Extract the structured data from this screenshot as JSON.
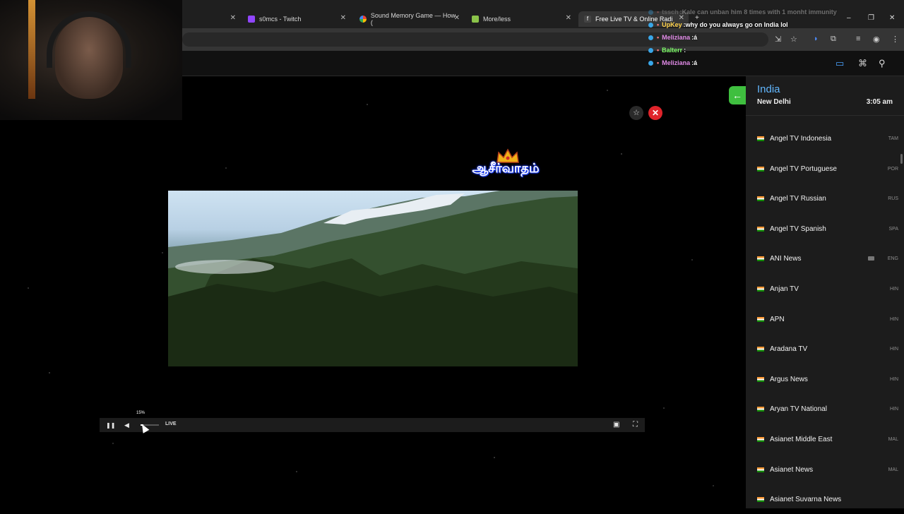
{
  "browser": {
    "tabs": [
      {
        "label": "",
        "active": false
      },
      {
        "label": "s0mcs - Twitch",
        "active": false
      },
      {
        "label": "Sound Memory Game — How (",
        "active": false
      },
      {
        "label": "More/less",
        "active": false
      },
      {
        "label": "Free Live TV & Online Radi",
        "active": true
      }
    ],
    "new_tab": "+",
    "window_controls": {
      "minimize": "–",
      "maximize": "❐",
      "close": "✕"
    }
  },
  "chat": {
    "messages": [
      {
        "user": "tssch",
        "text": "Kale can unban him 8 times with 1 monht immunity",
        "user_color": "#aaaaaa",
        "faded": true
      },
      {
        "user": "UpKey",
        "text": "why do you always go on India lol",
        "user_color": "#ffd24a",
        "faded": false
      },
      {
        "user": "Meliziana",
        "text": "á",
        "user_color": "#e08ae6",
        "faded": false
      },
      {
        "user": "Balterr",
        "text": "",
        "user_color": "#7fff6a",
        "faded": false
      },
      {
        "user": "Meliziana",
        "text": "á",
        "user_color": "#e08ae6",
        "faded": false
      }
    ]
  },
  "player": {
    "favorite_icon": "☆",
    "close_icon": "✕",
    "back_icon": "←",
    "overlay_text": "ஆசீர்வாதம்",
    "controls": {
      "pause_icon": "❚❚",
      "volume_icon": "◀",
      "volume_level": 0.15,
      "volume_tooltip": "15%",
      "live_label": "LIVE",
      "pip_icon": "▣",
      "fullscreen_icon": "⛶"
    }
  },
  "panel": {
    "country": "India",
    "city": "New Delhi",
    "time": "3:05 am",
    "channels": [
      {
        "name": "Angel TV Indonesia",
        "lang": "TAM"
      },
      {
        "name": "Angel TV Portuguese",
        "lang": "POR"
      },
      {
        "name": "Angel TV Russian",
        "lang": "RUS"
      },
      {
        "name": "Angel TV Spanish",
        "lang": "SPA"
      },
      {
        "name": "ANI News",
        "lang": "ENG",
        "camera": true
      },
      {
        "name": "Anjan TV",
        "lang": "HIN"
      },
      {
        "name": "APN",
        "lang": "HIN"
      },
      {
        "name": "Aradana TV",
        "lang": "HIN"
      },
      {
        "name": "Argus News",
        "lang": "HIN"
      },
      {
        "name": "Aryan TV National",
        "lang": "HIN"
      },
      {
        "name": "Asianet Middle East",
        "lang": "MAL"
      },
      {
        "name": "Asianet News",
        "lang": "MAL"
      },
      {
        "name": "Asianet Suvarna News",
        "lang": ""
      }
    ]
  },
  "colors": {
    "accent": "#62b7ff",
    "back_button": "#3fbf3f",
    "close_button": "#e0242b"
  }
}
